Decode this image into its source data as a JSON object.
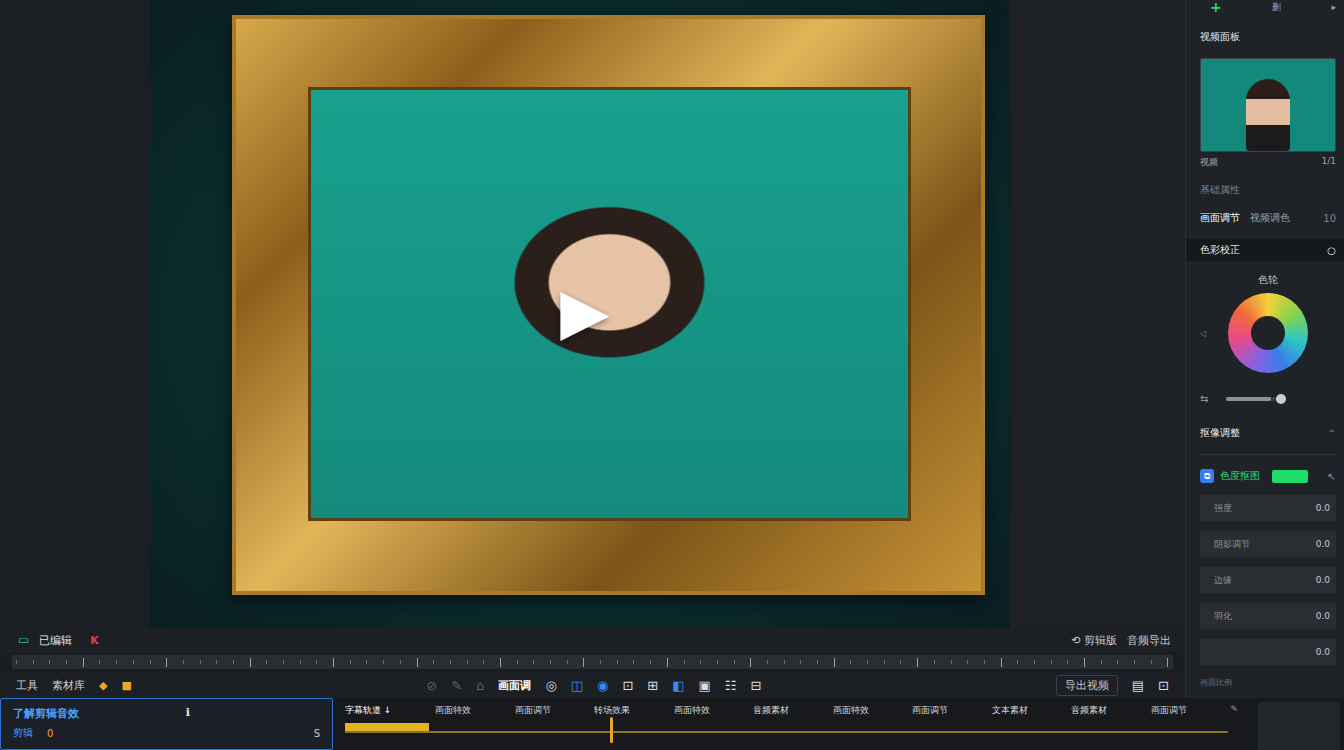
{
  "preview": {
    "play_icon": "▶"
  },
  "status_bar": {
    "left_icon": "▭",
    "left_label": "已编辑",
    "left_tag": "K",
    "right_items": [
      "⟲ 剪辑版",
      "音频导出"
    ]
  },
  "toolbar": {
    "left": [
      "工具",
      "素材库"
    ],
    "left_icons": [
      "◆",
      "■"
    ],
    "icons": [
      "⊘",
      "✎",
      "⌂"
    ],
    "center_label": "画面调",
    "tools": [
      "◎",
      "◫",
      "◉",
      "⊡",
      "⊞",
      "◧",
      "▣",
      "☷",
      "⊟"
    ],
    "right_button": "导出视频",
    "right_icons": [
      "▤",
      "⊡"
    ]
  },
  "inspector": {
    "add": "+",
    "delete_label": "删",
    "expand": "▸",
    "title": "视频面板",
    "thumb_caption": "视频",
    "thumb_count": "1/1",
    "sub": "基础属性",
    "tabs": [
      {
        "label": "画面调节",
        "selected": true
      },
      {
        "label": "视频调色",
        "selected": false
      }
    ],
    "tab_extra": "10",
    "section": "色彩校正",
    "section_icon": "○",
    "wheel_label": "色轮",
    "wheel_side": "◁",
    "slider_icon": "⇆",
    "slider_level": 0.75,
    "section2": "抠像调整",
    "section2_icon": "⌃",
    "chroma": {
      "icon": "⧉",
      "label": "色度抠图",
      "on": true,
      "key_color": "#1fdc6a",
      "pick_icon": "↖"
    },
    "fields": [
      {
        "label": "强度",
        "value": "0.0"
      },
      {
        "label": "阴影调节",
        "value": "0.0"
      },
      {
        "label": "边缘",
        "value": "0.0"
      },
      {
        "label": "羽化",
        "value": "0.0"
      },
      {
        "label": "",
        "value": "0.0"
      }
    ],
    "footer": "画面比例"
  },
  "timeline": {
    "panel": {
      "title": "了解剪辑音效",
      "tag_icon": "ℹ",
      "subtitle": "剪辑",
      "count": "0",
      "badge": "S"
    },
    "track_title": "字幕轨道 ↓",
    "clips": [
      "画面特效",
      "画面调节",
      "转场效果",
      "画面特效",
      "音频素材",
      "画面特效",
      "画面调节",
      "文本素材",
      "音频素材",
      "画面调节"
    ],
    "progress": 0.095,
    "playhead": 0.3,
    "end_icon": "✎"
  }
}
